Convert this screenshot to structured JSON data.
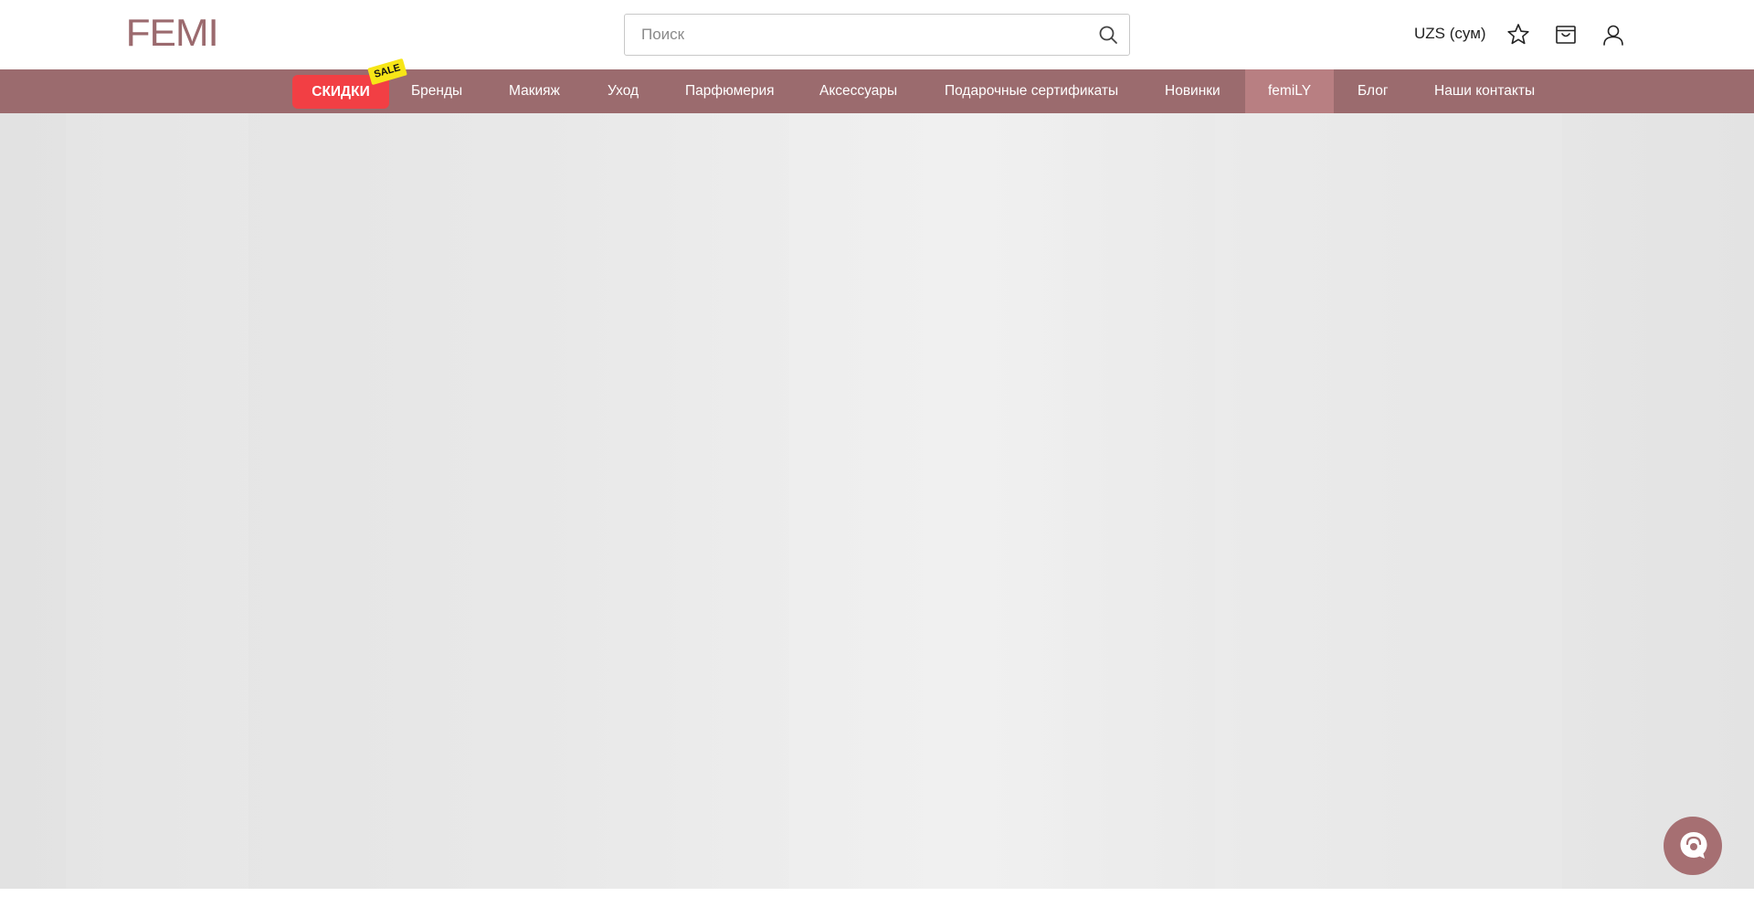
{
  "header": {
    "logo": "FEMI",
    "search_placeholder": "Поиск",
    "currency": "UZS (сум)"
  },
  "nav": {
    "sale": "СКИДКИ",
    "sale_badge": "SALE",
    "items": [
      "Бренды",
      "Макияж",
      "Уход",
      "Парфюмерия",
      "Аксессуары",
      "Подарочные сертификаты",
      "Новинки",
      "femiLY",
      "Блог",
      "Наши контакты"
    ],
    "active_item": "femiLY"
  },
  "colors": {
    "brand": "#9b6b6e",
    "nav_active": "#b87f82",
    "sale": "#f23f44",
    "sale_badge": "#f7e617"
  },
  "icons": [
    "search-icon",
    "star-icon",
    "cart-icon",
    "user-icon",
    "chat-icon"
  ]
}
